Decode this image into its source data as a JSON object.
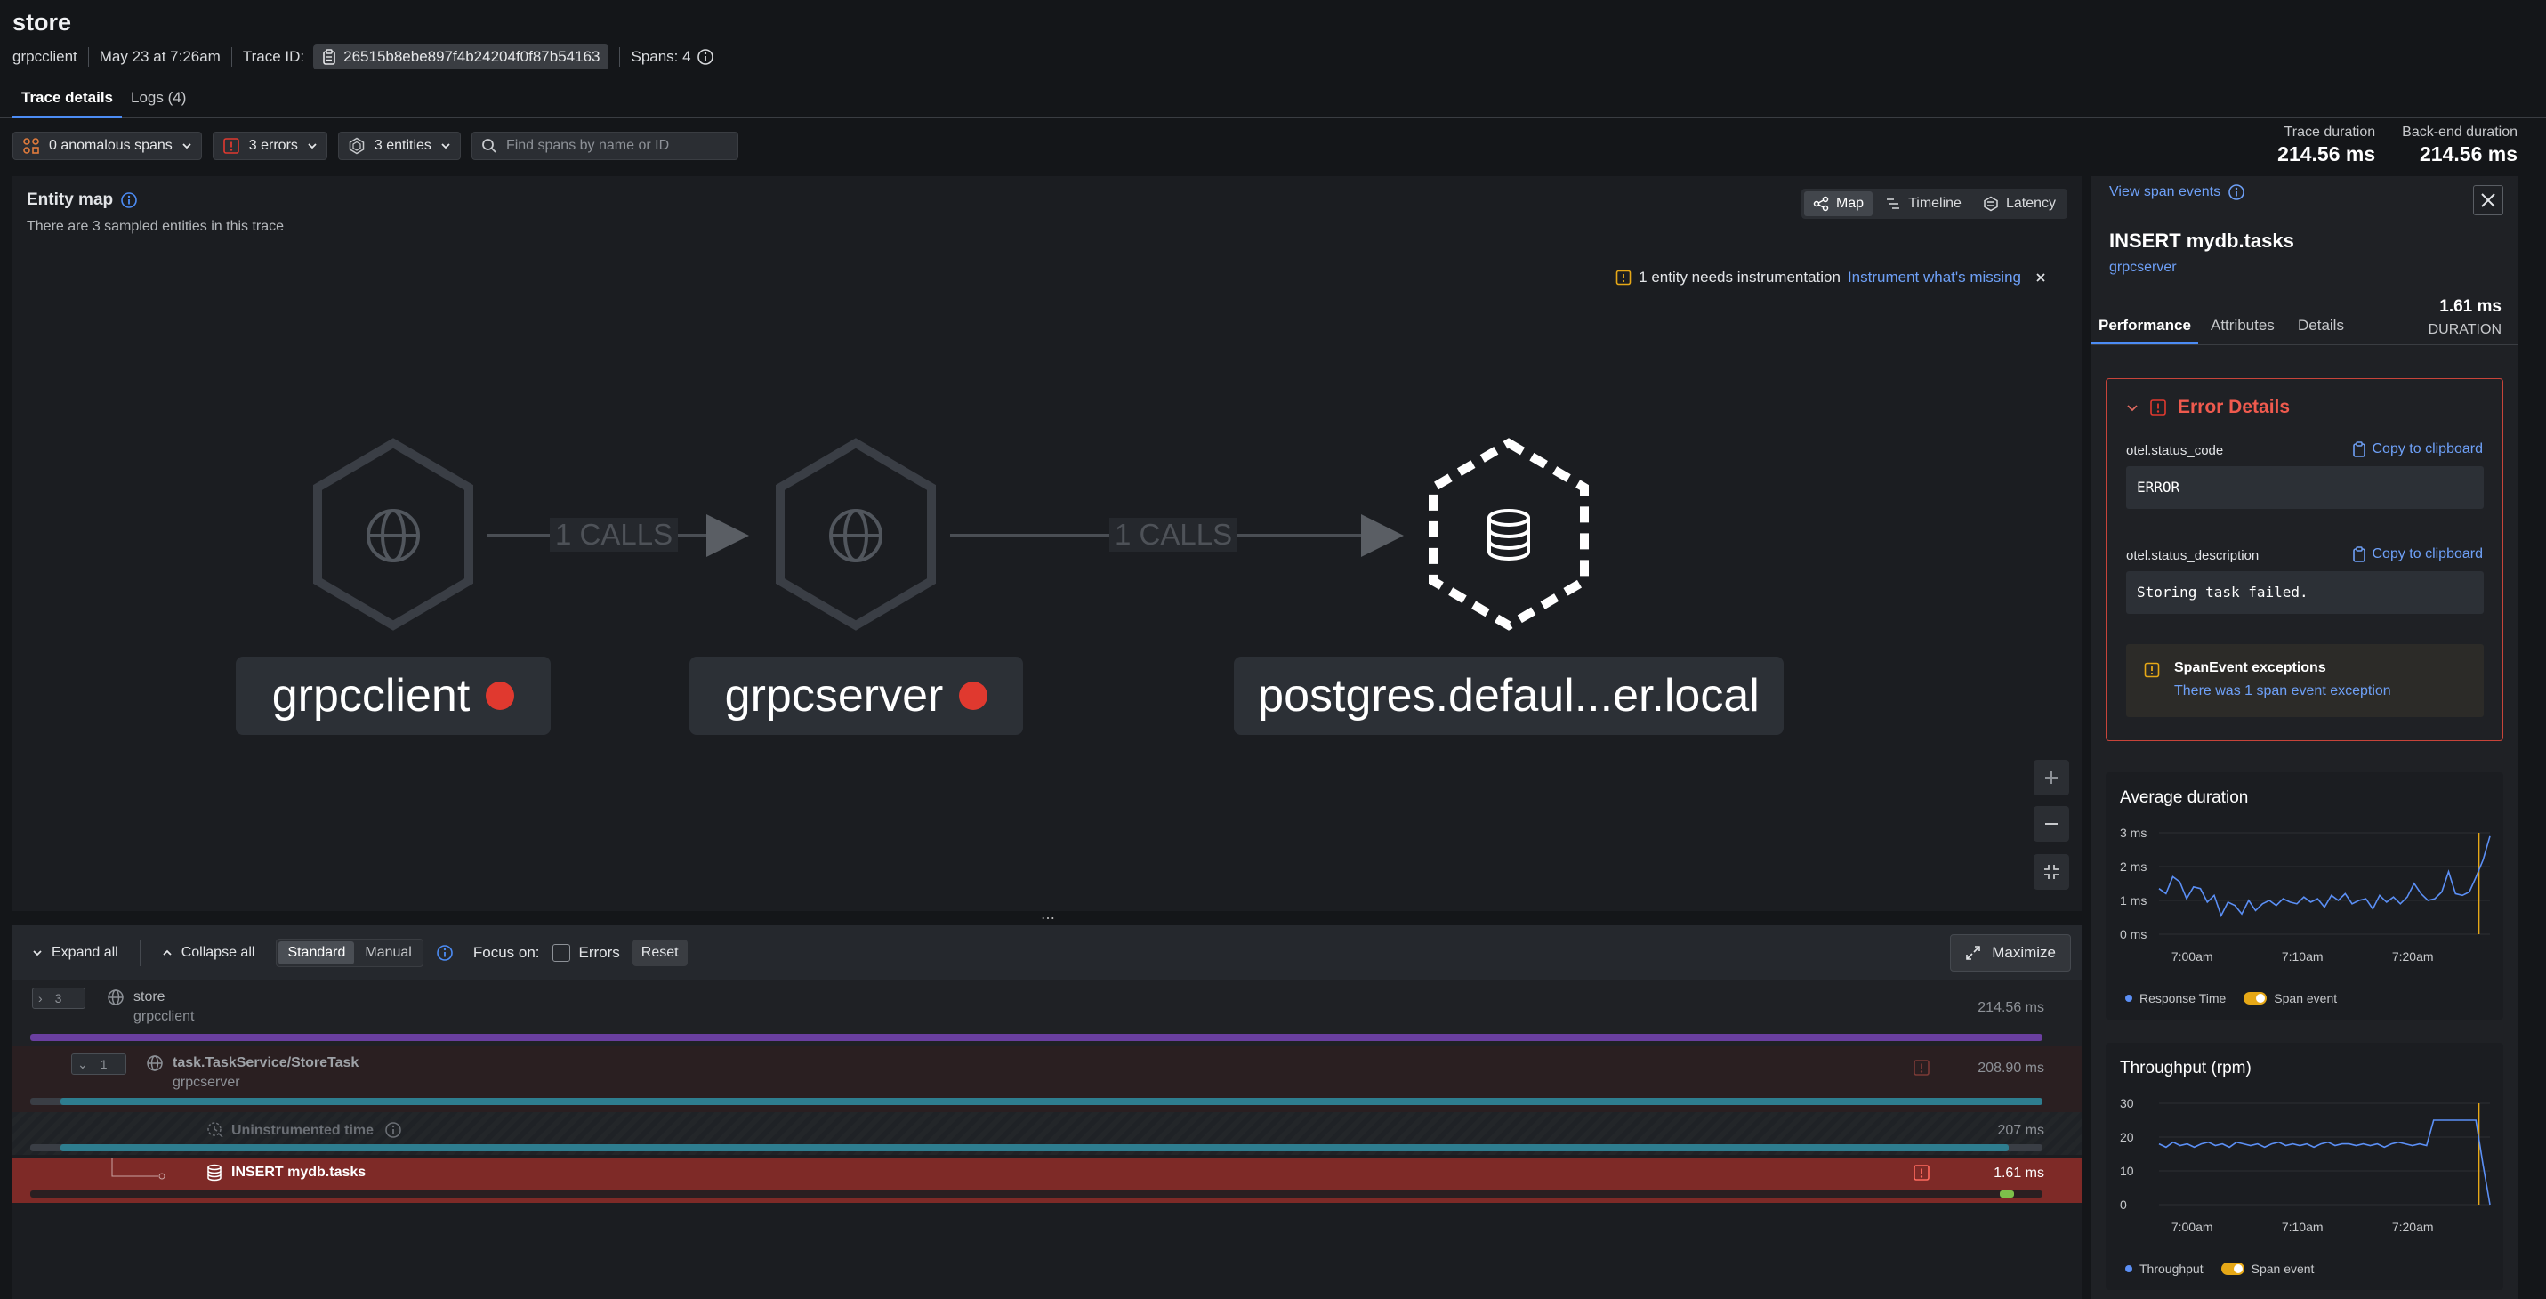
{
  "header": {
    "title": "store",
    "service": "grpcclient",
    "timestamp": "May 23 at 7:26am",
    "trace_id_label": "Trace ID:",
    "trace_id": "26515b8ebe897f4b24204f0f87b54163",
    "spans_label": "Spans: 4"
  },
  "tabs": [
    {
      "label": "Trace details"
    },
    {
      "label": "Logs (4)"
    }
  ],
  "filters": {
    "anomalous": "0 anomalous spans",
    "errors": "3 errors",
    "entities": "3 entities",
    "search_placeholder": "Find spans by name or ID"
  },
  "durations": {
    "trace_label": "Trace duration",
    "trace_value": "214.56 ms",
    "backend_label": "Back-end duration",
    "backend_value": "214.56 ms"
  },
  "entity_map": {
    "title": "Entity map",
    "subtitle": "There are 3 sampled entities in this trace",
    "views": [
      "Map",
      "Timeline",
      "Latency"
    ],
    "instrumentation_text": "1 entity needs instrumentation",
    "instrumentation_link": "Instrument what's missing",
    "entities": [
      {
        "name": "grpcclient",
        "error": true
      },
      {
        "name": "grpcserver",
        "error": true
      },
      {
        "name": "postgres.defaul...er.local",
        "error": false
      }
    ],
    "edges": [
      {
        "label": "1 CALLS"
      },
      {
        "label": "1 CALLS"
      }
    ]
  },
  "trace_list": {
    "expand_all": "Expand all",
    "collapse_all": "Collapse all",
    "mode_standard": "Standard",
    "mode_manual": "Manual",
    "focus_on": "Focus on:",
    "errors_checkbox": "Errors",
    "reset": "Reset",
    "maximize": "Maximize",
    "spans": [
      {
        "count": "3",
        "name": "store",
        "service": "grpcclient",
        "duration": "214.56 ms"
      },
      {
        "count": "1",
        "name": "task.TaskService/StoreTask",
        "service": "grpcserver",
        "duration": "208.90 ms"
      },
      {
        "name": "Uninstrumented time",
        "duration": "207 ms"
      },
      {
        "name": "INSERT mydb.tasks",
        "duration": "1.61 ms"
      }
    ]
  },
  "side_panel": {
    "view_span_events": "View span events",
    "span_name": "INSERT mydb.tasks",
    "service": "grpcserver",
    "tabs": [
      "Performance",
      "Attributes",
      "Details"
    ],
    "duration_value": "1.61 ms",
    "duration_label": "DURATION",
    "error_details": {
      "title": "Error Details",
      "copy_label": "Copy to clipboard",
      "fields": [
        {
          "key": "otel.status_code",
          "value": "ERROR"
        },
        {
          "key": "otel.status_description",
          "value": "Storing task failed."
        }
      ],
      "exception_title": "SpanEvent exceptions",
      "exception_link": "There was 1 span event exception"
    }
  },
  "chart_data": [
    {
      "type": "line",
      "title": "Average duration",
      "y_ticks": [
        "3 ms",
        "2 ms",
        "1 ms",
        "0 ms"
      ],
      "ylim": [
        0,
        3
      ],
      "x_ticks": [
        "7:00am",
        "7:10am",
        "7:20am"
      ],
      "x_tick_positions": [
        3,
        13,
        23
      ],
      "series": [
        {
          "name": "Response Time",
          "values": [
            1.35,
            1.2,
            1.7,
            1.55,
            1.05,
            1.4,
            1.35,
            0.95,
            1.15,
            0.55,
            0.95,
            0.85,
            0.6,
            1.0,
            0.7,
            0.9,
            1.0,
            0.85,
            1.05,
            0.95,
            0.9,
            1.1,
            0.95,
            1.05,
            0.8,
            1.15,
            1.0,
            1.2,
            0.9,
            1.0,
            1.05,
            0.75,
            1.15,
            0.95,
            1.1,
            0.9,
            1.1,
            1.5,
            1.2,
            1.0,
            1.05,
            1.25,
            1.85,
            1.2,
            1.15,
            1.25,
            1.7,
            2.2,
            2.9
          ]
        }
      ],
      "event_marker_x": 29,
      "legend": [
        "Response Time",
        "Span event"
      ]
    },
    {
      "type": "line",
      "title": "Throughput (rpm)",
      "y_ticks": [
        "30",
        "20",
        "10",
        "0"
      ],
      "ylim": [
        0,
        30
      ],
      "x_ticks": [
        "7:00am",
        "7:10am",
        "7:20am"
      ],
      "x_tick_positions": [
        3,
        13,
        23
      ],
      "series": [
        {
          "name": "Throughput",
          "values": [
            18,
            17,
            18.5,
            17.5,
            18,
            17,
            18,
            18.5,
            17.5,
            18,
            17,
            18.5,
            18,
            17.5,
            18,
            17,
            18,
            18.5,
            17.5,
            18,
            17.5,
            18,
            17,
            18,
            18.5,
            17.5,
            18,
            18,
            17.5,
            18,
            17.5,
            18,
            17,
            18,
            18.5,
            18,
            17.5,
            18,
            17.5,
            25,
            25,
            25,
            25,
            25,
            25,
            25,
            12,
            0
          ]
        }
      ],
      "event_marker_x": 29,
      "legend": [
        "Throughput",
        "Span event"
      ]
    }
  ],
  "colors": {
    "accent": "#4c8cf5",
    "error": "#e0392f",
    "chart_line": "#5b8ff5",
    "event": "#e6a817",
    "purple_bar": "#6a3fa0",
    "teal_bar": "#2e7d8f"
  }
}
